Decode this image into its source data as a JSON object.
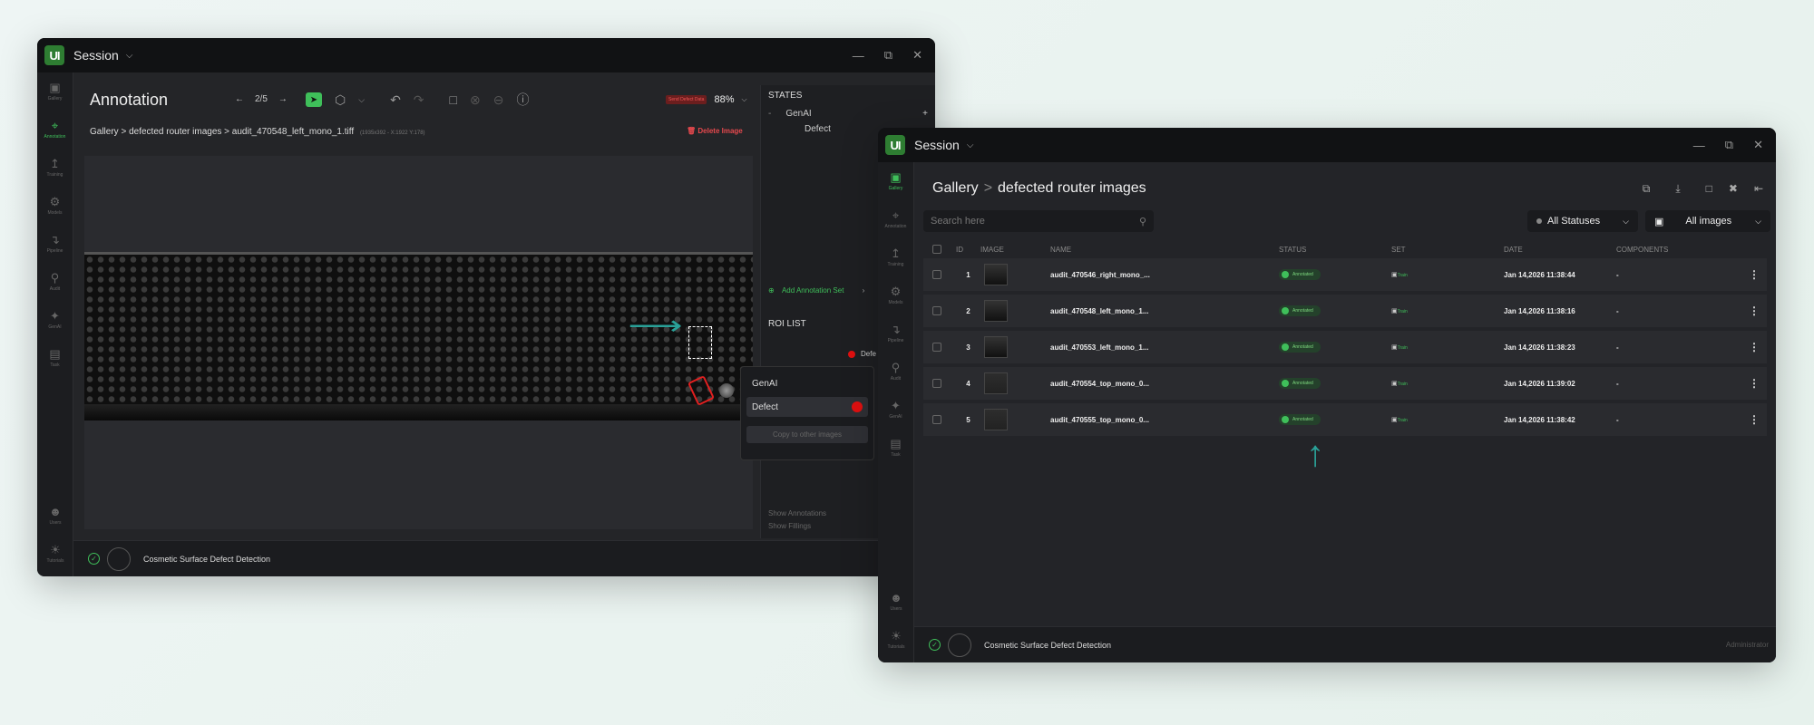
{
  "window1": {
    "title": "Session",
    "page_title": "Annotation",
    "pager": "2/5",
    "zoom": "88%",
    "send_badge": "Send Defect Data",
    "breadcrumb": {
      "gallery": "Gallery",
      "folder": "defected router images",
      "file": "audit_470548_left_mono_1.tiff",
      "meta": "(1935x392 - X:1922 Y:178)"
    },
    "delete_label": "Delete Image",
    "states_title": "STATES",
    "states": [
      "GenAI",
      "Defect"
    ],
    "add_annotation_set": "Add Annotation Set",
    "roi_title": "ROI LIST",
    "roi_item": "Defe",
    "context_menu": {
      "items": [
        "GenAI",
        "Defect"
      ],
      "copy_label": "Copy to other images"
    },
    "show_annotations": "Show Annotations",
    "show_fillings": "Show Fillings",
    "footer_project": "Cosmetic Surface Defect Detection"
  },
  "sidebar": [
    {
      "label": "Gallery",
      "icon": "gallery-icon"
    },
    {
      "label": "Annotation",
      "icon": "crop-icon"
    },
    {
      "label": "Training",
      "icon": "chart-icon"
    },
    {
      "label": "Models",
      "icon": "gear-icon"
    },
    {
      "label": "Pipeline",
      "icon": "pipeline-icon"
    },
    {
      "label": "Audit",
      "icon": "search-icon"
    },
    {
      "label": "GenAI",
      "icon": "wand-icon"
    },
    {
      "label": "Task",
      "icon": "clipboard-icon"
    }
  ],
  "sidebar_bottom": [
    {
      "label": "Users",
      "icon": "user-icon"
    },
    {
      "label": "Tutorials",
      "icon": "bulb-icon"
    }
  ],
  "window2": {
    "title": "Session",
    "breadcrumb": {
      "gallery": "Gallery",
      "sep": ">",
      "folder": "defected router images"
    },
    "search_placeholder": "Search here",
    "status_filter": "All Statuses",
    "images_filter": "All images",
    "columns": [
      "ID",
      "IMAGE",
      "NAME",
      "STATUS",
      "SET",
      "DATE",
      "COMPONENTS"
    ],
    "rows": [
      {
        "id": "1",
        "name": "audit_470546_right_mono_...",
        "status": "Annotated",
        "set": "Train",
        "date": "Jan 14,2026 11:38:44",
        "components": "-"
      },
      {
        "id": "2",
        "name": "audit_470548_left_mono_1...",
        "status": "Annotated",
        "set": "Train",
        "date": "Jan 14,2026 11:38:16",
        "components": "-"
      },
      {
        "id": "3",
        "name": "audit_470553_left_mono_1...",
        "status": "Annotated",
        "set": "Train",
        "date": "Jan 14,2026 11:38:23",
        "components": "-"
      },
      {
        "id": "4",
        "name": "audit_470554_top_mono_0...",
        "status": "Annotated",
        "set": "Train",
        "date": "Jan 14,2026 11:39:02",
        "components": "-"
      },
      {
        "id": "5",
        "name": "audit_470555_top_mono_0...",
        "status": "Annotated",
        "set": "Train",
        "date": "Jan 14,2026 11:38:42",
        "components": "-"
      }
    ],
    "footer_project": "Cosmetic Surface Defect Detection",
    "footer_user": "Administrator"
  },
  "colors": {
    "accent": "#3fbf5a",
    "danger": "#e5484d",
    "arrow": "#2aa198"
  }
}
